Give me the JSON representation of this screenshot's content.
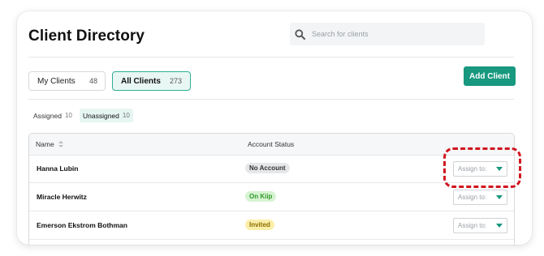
{
  "header": {
    "title": "Client Directory",
    "search_placeholder": "Search for clients"
  },
  "segments": [
    {
      "label": "My Clients",
      "count": "48",
      "active": false
    },
    {
      "label": "All Clients",
      "count": "273",
      "active": true
    }
  ],
  "add_button_label": "Add Client",
  "filters": [
    {
      "label": "Assigned",
      "count": "10",
      "active": false
    },
    {
      "label": "Unassigned",
      "count": "10",
      "active": true
    }
  ],
  "table": {
    "columns": [
      "Name",
      "Account Status"
    ],
    "rows": [
      {
        "name": "Hanna Lubin",
        "status": "No Account",
        "assign_placeholder": "Assign to:"
      },
      {
        "name": "Miracle Herwitz",
        "status": "On Kiip",
        "assign_placeholder": "Assign to:"
      },
      {
        "name": "Emerson Ekstrom Bothman",
        "status": "Invited",
        "assign_placeholder": "Assign to:"
      }
    ]
  },
  "colors": {
    "accent": "#17987f",
    "badge_no_account_bg": "#e6e7e9",
    "badge_on_kiip_bg": "#d7f3d2",
    "badge_on_kiip_text": "#2e9a2a",
    "badge_invited_bg": "#fbeea8",
    "badge_invited_text": "#8a6d00",
    "highlight": "#d0151f"
  }
}
